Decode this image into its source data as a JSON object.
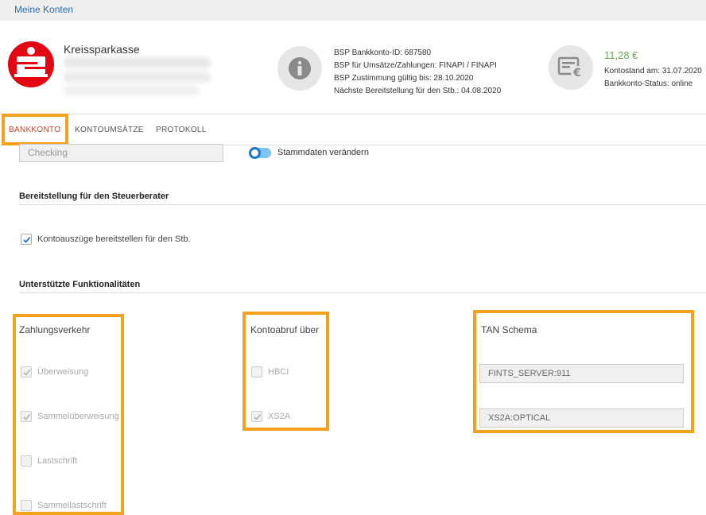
{
  "breadcrumb": {
    "link": "Meine Konten"
  },
  "bank": {
    "name": "Kreissparkasse"
  },
  "info": {
    "line1": "BSP Bankkonto-ID: 687580",
    "line2": "BSP für Umsätze/Zahlungen: FINAPI / FINAPI",
    "line3": "BSP Zustimmung gültig bis: 28.10.2020",
    "line4": "Nächste Bereitstellung für den Stb.: 04.08.2020"
  },
  "balance": {
    "amount": "11,28 €",
    "date": "Kontostand am: 31.07.2020",
    "status": "Bankkonto-Status: online"
  },
  "tabs": [
    {
      "label": "BANKKONTO"
    },
    {
      "label": "KONTOUMSÄTZE"
    },
    {
      "label": "PROTOKOLL"
    }
  ],
  "account_type": {
    "value": "Checking"
  },
  "toggle": {
    "label": "Stammdaten verändern",
    "on": true
  },
  "provision": {
    "title": "Bereitstellung für den Steuerberater",
    "checkbox_label": "Kontoauszüge bereitstellen für den Stb.",
    "checked": true
  },
  "features": {
    "title": "Unterstützte Funktionalitäten",
    "payments": {
      "title": "Zahlungsverkehr",
      "items": [
        {
          "label": "Überweisung",
          "checked": true
        },
        {
          "label": "Sammelüberweisung",
          "checked": true
        },
        {
          "label": "Lastschrift",
          "checked": false
        },
        {
          "label": "Sammellastschrift",
          "checked": false
        }
      ]
    },
    "retrieval": {
      "title": "Kontoabruf über",
      "items": [
        {
          "label": "HBCI",
          "checked": false
        },
        {
          "label": "XS2A",
          "checked": true
        }
      ]
    },
    "tan": {
      "title": "TAN Schema",
      "values": [
        "FINTS_SERVER:911",
        "XS2A:OPTICAL"
      ]
    }
  },
  "colors": {
    "highlight": "#f5a11c",
    "active_tab": "#c0462f",
    "link": "#2f6fa7",
    "amount": "#6aa84f",
    "toggle": "#1976d2"
  }
}
